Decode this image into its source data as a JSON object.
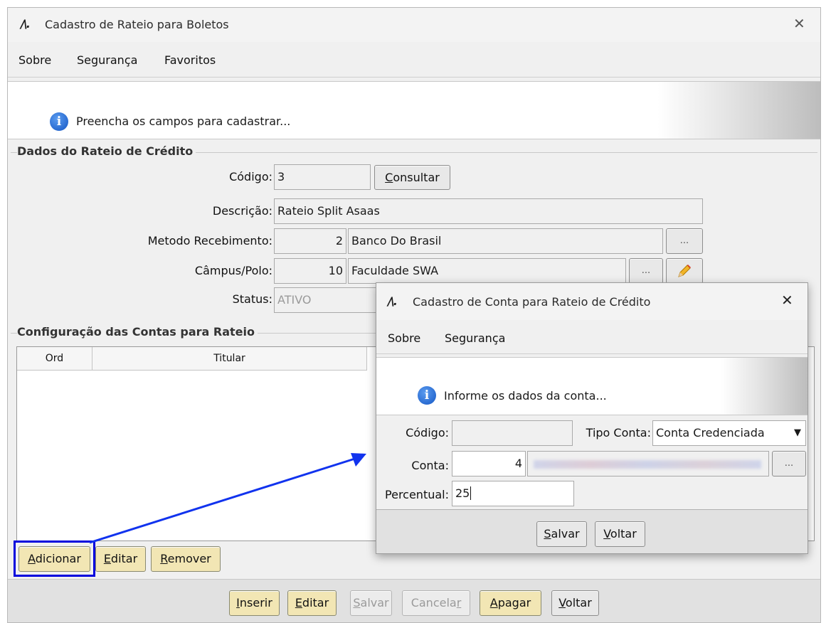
{
  "main_window": {
    "title": "Cadastro de Rateio para Boletos",
    "close_glyph": "✕",
    "menu": [
      "Sobre",
      "Segurança",
      "Favoritos"
    ],
    "info_message": "Preencha os campos para cadastrar...",
    "group_rateio": "Dados do Rateio de Crédito",
    "codigo_label": "Código:",
    "codigo_value": "3",
    "consultar_label": "Consultar",
    "descricao_label": "Descrição:",
    "descricao_value": "Rateio Split Asaas",
    "metodo_label": "Metodo Recebimento:",
    "metodo_code": "2",
    "metodo_name": "Banco Do Brasil",
    "campus_label": "Câmpus/Polo:",
    "campus_code": "10",
    "campus_name": "Faculdade SWA",
    "status_label": "Status:",
    "status_value": "ATIVO",
    "ellipsis": "...",
    "group_contas": "Configuração das Contas para Rateio",
    "table_headers": [
      "Ord",
      "Titular"
    ],
    "buttons_contas": [
      "Adicionar",
      "Editar",
      "Remover"
    ],
    "bottom_buttons": [
      "Inserir",
      "Editar",
      "Salvar",
      "Cancelar",
      "Apagar",
      "Voltar"
    ]
  },
  "dialog": {
    "title": "Cadastro de Conta para Rateio de Crédito",
    "close_glyph": "✕",
    "menu": [
      "Sobre",
      "Segurança"
    ],
    "info_message": "Informe os dados da conta...",
    "codigo_label": "Código:",
    "codigo_value": "",
    "tipo_conta_label": "Tipo Conta:",
    "tipo_conta_value": "Conta Credenciada",
    "conta_label": "Conta:",
    "conta_code": "4",
    "ellipsis": "...",
    "percentual_label": "Percentual:",
    "percentual_value": "25",
    "salvar_label": "Salvar",
    "voltar_label": "Voltar"
  },
  "colors": {
    "highlight": "#0000dd",
    "arrow": "#1133ee",
    "button_yellow": "#f2e6b4"
  },
  "icons": [
    "app-logo-icon",
    "close-icon",
    "info-icon",
    "pencil-icon",
    "dropdown-arrow-icon"
  ]
}
